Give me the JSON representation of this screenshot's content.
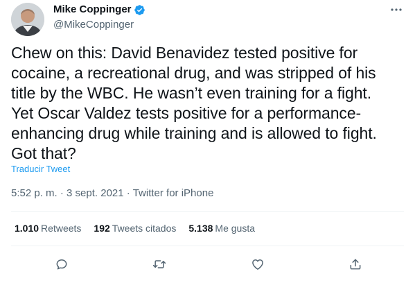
{
  "author": {
    "name": "Mike Coppinger",
    "handle": "@MikeCoppinger",
    "verified": true
  },
  "tweet": {
    "text": "Chew on this: David Benavidez tested positive for\ncocaine, a recreational drug, and was stripped of his\ntitle by the WBC. He wasn’t even training for a fight.\nYet Oscar Valdez tests positive for a performance-\nenhancing drug while training and is allowed to fight.\nGot that?",
    "translate_label": "Traducir Tweet",
    "time": "5:52 p. m.",
    "date": "3 sept. 2021",
    "source": "Twitter for iPhone",
    "separator": " · "
  },
  "stats": {
    "retweets": {
      "count": "1.010",
      "label": "Retweets"
    },
    "quotes": {
      "count": "192",
      "label": "Tweets citados"
    },
    "likes": {
      "count": "5.138",
      "label": "Me gusta"
    }
  },
  "icons": {
    "verified": "verified-badge-icon",
    "more": "more-icon",
    "reply": "reply-icon",
    "retweet": "retweet-icon",
    "like": "like-icon",
    "share": "share-icon"
  },
  "colors": {
    "accent": "#1d9bf0",
    "text": "#0f1419",
    "secondary": "#536471",
    "divider": "#eff3f4"
  }
}
